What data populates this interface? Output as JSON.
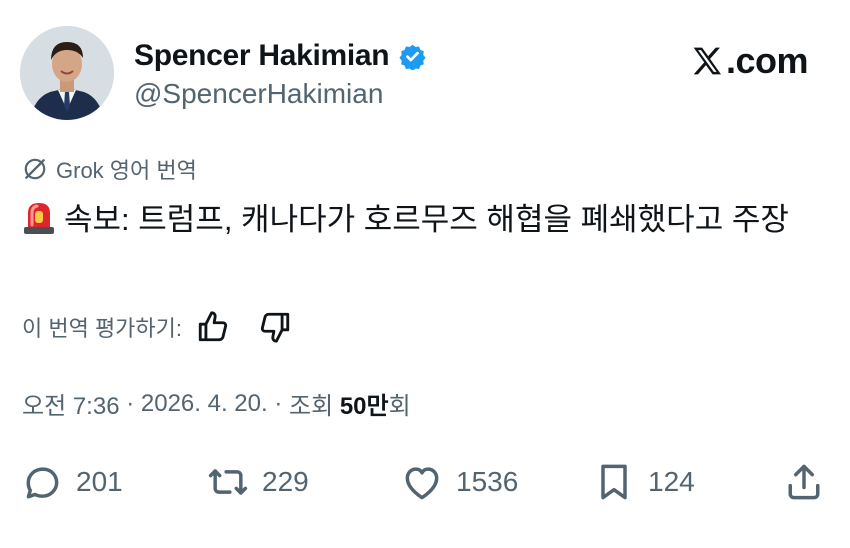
{
  "author": {
    "display_name": "Spencer Hakimian",
    "handle": "@SpencerHakimian",
    "verified_color": "#1d9bf0"
  },
  "brand": {
    "label": ".com"
  },
  "translation": {
    "label": "Grok 영어 번역"
  },
  "tweet": {
    "emoji": "rotating-light-icon",
    "text": "속보: 트럼프, 캐나다가 호르무즈 해협을 폐쇄했다고 주장"
  },
  "rating": {
    "label": "이 번역 평가하기:"
  },
  "meta": {
    "time": "오전 7:36",
    "sep1": " · ",
    "date": "2026. 4. 20.",
    "sep2": " · ",
    "views_prefix": "조회 ",
    "views_count": "50만",
    "views_suffix": "회"
  },
  "actions": {
    "replies": "201",
    "reposts": "229",
    "likes": "1536",
    "bookmarks": "124"
  },
  "colors": {
    "text": "#0f1419",
    "muted": "#536471",
    "accent": "#1d9bf0"
  }
}
